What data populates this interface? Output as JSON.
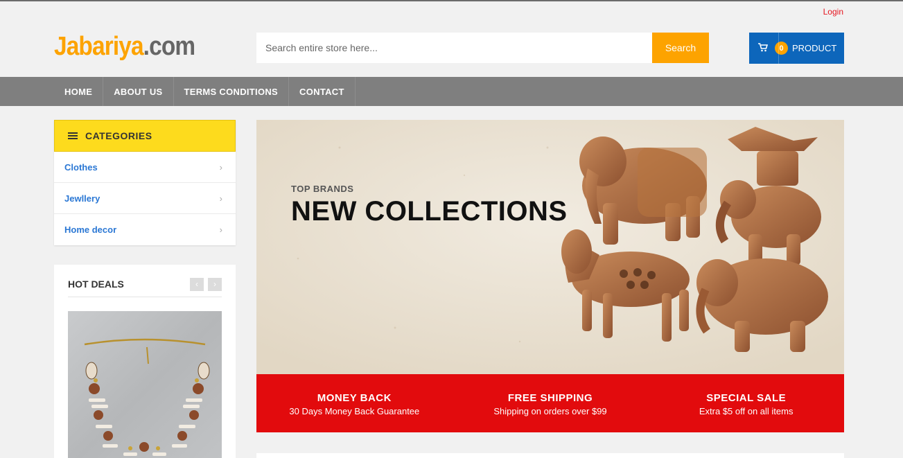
{
  "topbar": {
    "login": "Login"
  },
  "header": {
    "logo_part1": "Jabariya",
    "logo_part2": ".com",
    "search_placeholder": "Search entire store here...",
    "search_button": "Search",
    "cart_count": "0",
    "cart_label": "PRODUCT"
  },
  "nav": {
    "items": [
      "HOME",
      "ABOUT US",
      "TERMS CONDITIONS",
      "CONTACT"
    ]
  },
  "categories": {
    "title": "CATEGORIES",
    "items": [
      "Clothes",
      "Jewllery",
      "Home decor"
    ]
  },
  "hot_deals": {
    "title": "HOT DEALS"
  },
  "hero": {
    "subtitle": "TOP BRANDS",
    "title": "NEW COLLECTIONS"
  },
  "features": [
    {
      "title": "MONEY BACK",
      "desc": "30 Days Money Back Guarantee"
    },
    {
      "title": "FREE SHIPPING",
      "desc": "Shipping on orders over $99"
    },
    {
      "title": "SPECIAL SALE",
      "desc": "Extra $5 off on all items"
    }
  ],
  "colors": {
    "accent_orange": "#fda300",
    "cart_blue": "#0d66bb",
    "nav_gray": "#7f7f7f",
    "category_yellow": "#fddb1d",
    "feature_red": "#e20b0d",
    "link_blue": "#2a77d4"
  }
}
